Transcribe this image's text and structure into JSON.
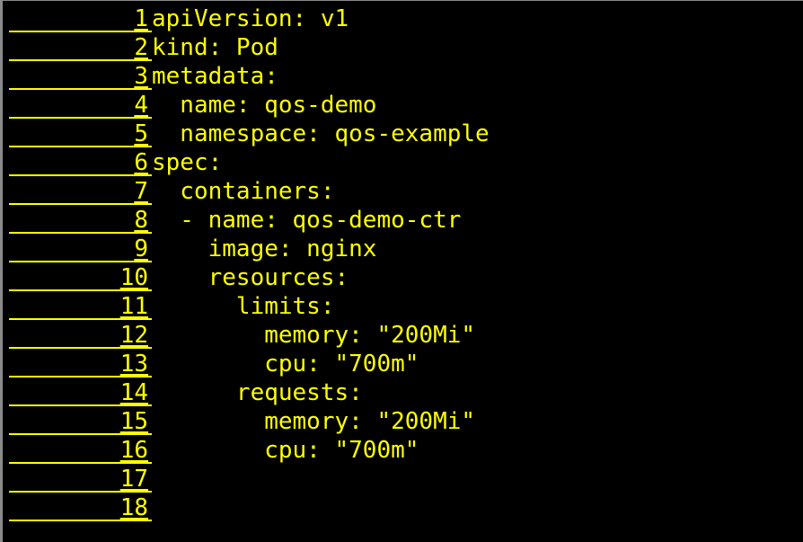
{
  "editor": {
    "lines": [
      {
        "num": "1",
        "text": "apiVersion: v1"
      },
      {
        "num": "2",
        "text": "kind: Pod"
      },
      {
        "num": "3",
        "text": "metadata:"
      },
      {
        "num": "4",
        "text": "  name: qos-demo"
      },
      {
        "num": "5",
        "text": "  namespace: qos-example"
      },
      {
        "num": "6",
        "text": "spec:"
      },
      {
        "num": "7",
        "text": "  containers:"
      },
      {
        "num": "8",
        "text": "  - name: qos-demo-ctr"
      },
      {
        "num": "9",
        "text": "    image: nginx"
      },
      {
        "num": "10",
        "text": "    resources:"
      },
      {
        "num": "11",
        "text": "      limits:"
      },
      {
        "num": "12",
        "text": "        memory: \"200Mi\""
      },
      {
        "num": "13",
        "text": "        cpu: \"700m\""
      },
      {
        "num": "14",
        "text": "      requests:"
      },
      {
        "num": "15",
        "text": "        memory: \"200Mi\""
      },
      {
        "num": "16",
        "text": "        cpu: \"700m\""
      },
      {
        "num": "17",
        "text": ""
      },
      {
        "num": "18",
        "text": ""
      }
    ]
  },
  "colors": {
    "background": "#000000",
    "text": "#ffff00"
  }
}
